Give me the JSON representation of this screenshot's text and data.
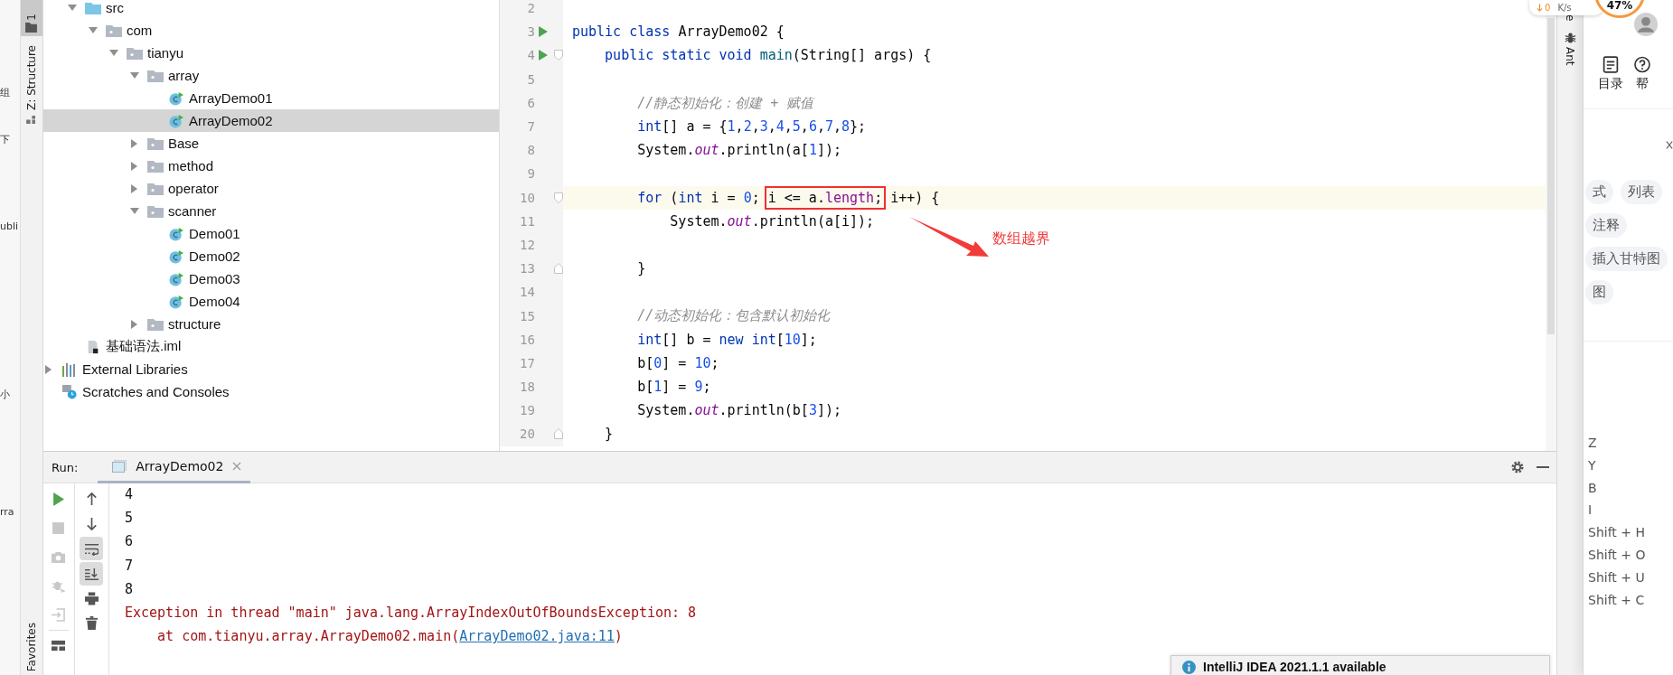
{
  "edge_fragments": [
    "组",
    "下",
    "ubli",
    "小",
    "rra"
  ],
  "tool_strip": {
    "project_tab": "1",
    "structure_tab": "Z: Structure",
    "favorites_tab": "Favorites"
  },
  "tree": {
    "module_children": [
      {
        "label": "src",
        "kind": "source-folder",
        "expanded": true,
        "selected": false,
        "children": [
          {
            "label": "com",
            "kind": "package",
            "expanded": true,
            "selected": false,
            "children": [
              {
                "label": "tianyu",
                "kind": "package",
                "expanded": true,
                "selected": false,
                "children": [
                  {
                    "label": "array",
                    "kind": "package",
                    "expanded": true,
                    "selected": false,
                    "children": [
                      {
                        "label": "ArrayDemo01",
                        "kind": "class",
                        "selected": false
                      },
                      {
                        "label": "ArrayDemo02",
                        "kind": "class",
                        "selected": true
                      }
                    ]
                  },
                  {
                    "label": "Base",
                    "kind": "package",
                    "expanded": false,
                    "selected": false
                  },
                  {
                    "label": "method",
                    "kind": "package",
                    "expanded": false,
                    "selected": false
                  },
                  {
                    "label": "operator",
                    "kind": "package",
                    "expanded": false,
                    "selected": false
                  },
                  {
                    "label": "scanner",
                    "kind": "package",
                    "expanded": true,
                    "selected": false,
                    "children": [
                      {
                        "label": "Demo01",
                        "kind": "class",
                        "selected": false
                      },
                      {
                        "label": "Demo02",
                        "kind": "class",
                        "selected": false
                      },
                      {
                        "label": "Demo03",
                        "kind": "class",
                        "selected": false
                      },
                      {
                        "label": "Demo04",
                        "kind": "class",
                        "selected": false
                      }
                    ]
                  },
                  {
                    "label": "structure",
                    "kind": "package",
                    "expanded": false,
                    "selected": false
                  }
                ]
              }
            ]
          }
        ]
      },
      {
        "label": "基础语法.iml",
        "kind": "module-file",
        "selected": false
      }
    ],
    "roots": [
      {
        "label": "External Libraries",
        "kind": "libraries",
        "expanded": false,
        "selected": false
      },
      {
        "label": "Scratches and Consoles",
        "kind": "scratches",
        "selected": false
      }
    ]
  },
  "editor": {
    "lines": [
      {
        "number": "2",
        "run": false,
        "fold_open": false,
        "fold_close": false,
        "current": false
      },
      {
        "number": "3",
        "run": true,
        "fold_open": false,
        "fold_close": false,
        "current": false,
        "tokens": [
          {
            "text": "public class ",
            "kind": "keyword"
          },
          {
            "text": "ArrayDemo02 {",
            "kind": "plain"
          }
        ]
      },
      {
        "number": "4",
        "run": true,
        "fold_open": true,
        "fold_close": false,
        "current": false,
        "tokens": [
          {
            "text": "    public static void ",
            "kind": "keyword"
          },
          {
            "text": "main",
            "kind": "method-decl"
          },
          {
            "text": "(String[] args) {",
            "kind": "plain"
          }
        ]
      },
      {
        "number": "5",
        "run": false,
        "fold_open": false,
        "fold_close": false,
        "current": false
      },
      {
        "number": "6",
        "run": false,
        "fold_open": false,
        "fold_close": false,
        "current": false,
        "tokens": [
          {
            "text": "        //静态初始化：创建 + 赋值",
            "kind": "comment"
          }
        ]
      },
      {
        "number": "7",
        "run": false,
        "fold_open": false,
        "fold_close": false,
        "current": false,
        "tokens": [
          {
            "text": "        int",
            "kind": "keyword"
          },
          {
            "text": "[] a = {",
            "kind": "plain"
          },
          {
            "text": "1",
            "kind": "number"
          },
          {
            "text": ",",
            "kind": "plain"
          },
          {
            "text": "2",
            "kind": "number"
          },
          {
            "text": ",",
            "kind": "plain"
          },
          {
            "text": "3",
            "kind": "number"
          },
          {
            "text": ",",
            "kind": "plain"
          },
          {
            "text": "4",
            "kind": "number"
          },
          {
            "text": ",",
            "kind": "plain"
          },
          {
            "text": "5",
            "kind": "number"
          },
          {
            "text": ",",
            "kind": "plain"
          },
          {
            "text": "6",
            "kind": "number"
          },
          {
            "text": ",",
            "kind": "plain"
          },
          {
            "text": "7",
            "kind": "number"
          },
          {
            "text": ",",
            "kind": "plain"
          },
          {
            "text": "8",
            "kind": "number"
          },
          {
            "text": "};",
            "kind": "plain"
          }
        ]
      },
      {
        "number": "8",
        "run": false,
        "fold_open": false,
        "fold_close": false,
        "current": false,
        "tokens": [
          {
            "text": "        System.",
            "kind": "plain"
          },
          {
            "text": "out",
            "kind": "static-field"
          },
          {
            "text": ".println(a[",
            "kind": "plain"
          },
          {
            "text": "1",
            "kind": "number"
          },
          {
            "text": "]);",
            "kind": "plain"
          }
        ]
      },
      {
        "number": "9",
        "run": false,
        "fold_open": false,
        "fold_close": false,
        "current": false
      },
      {
        "number": "10",
        "run": false,
        "fold_open": true,
        "fold_close": false,
        "current": true,
        "tokens": [
          {
            "text": "        for ",
            "kind": "keyword"
          },
          {
            "text": "(",
            "kind": "plain"
          },
          {
            "text": "int ",
            "kind": "keyword"
          },
          {
            "text": "i = ",
            "kind": "plain"
          },
          {
            "text": "0",
            "kind": "number"
          },
          {
            "text": "; ",
            "kind": "plain"
          },
          {
            "kind": "box",
            "tokens": [
              {
                "text": "i <= a.",
                "kind": "plain"
              },
              {
                "text": "length",
                "kind": "field"
              },
              {
                "text": ";",
                "kind": "plain"
              }
            ]
          },
          {
            "text": " i++) {",
            "kind": "plain"
          }
        ]
      },
      {
        "number": "11",
        "run": false,
        "fold_open": false,
        "fold_close": false,
        "current": false,
        "tokens": [
          {
            "text": "            System.",
            "kind": "plain"
          },
          {
            "text": "out",
            "kind": "static-field"
          },
          {
            "text": ".println(a[i]);",
            "kind": "plain"
          }
        ]
      },
      {
        "number": "12",
        "run": false,
        "fold_open": false,
        "fold_close": false,
        "current": false
      },
      {
        "number": "13",
        "run": false,
        "fold_open": false,
        "fold_close": true,
        "current": false,
        "tokens": [
          {
            "text": "        }",
            "kind": "plain"
          }
        ]
      },
      {
        "number": "14",
        "run": false,
        "fold_open": false,
        "fold_close": false,
        "current": false
      },
      {
        "number": "15",
        "run": false,
        "fold_open": false,
        "fold_close": false,
        "current": false,
        "tokens": [
          {
            "text": "        //动态初始化：包含默认初始化",
            "kind": "comment"
          }
        ]
      },
      {
        "number": "16",
        "run": false,
        "fold_open": false,
        "fold_close": false,
        "current": false,
        "tokens": [
          {
            "text": "        int",
            "kind": "keyword"
          },
          {
            "text": "[] b = ",
            "kind": "plain"
          },
          {
            "text": "new int",
            "kind": "keyword"
          },
          {
            "text": "[",
            "kind": "plain"
          },
          {
            "text": "10",
            "kind": "number"
          },
          {
            "text": "];",
            "kind": "plain"
          }
        ]
      },
      {
        "number": "17",
        "run": false,
        "fold_open": false,
        "fold_close": false,
        "current": false,
        "tokens": [
          {
            "text": "        b[",
            "kind": "plain"
          },
          {
            "text": "0",
            "kind": "number"
          },
          {
            "text": "] = ",
            "kind": "plain"
          },
          {
            "text": "10",
            "kind": "number"
          },
          {
            "text": ";",
            "kind": "plain"
          }
        ]
      },
      {
        "number": "18",
        "run": false,
        "fold_open": false,
        "fold_close": false,
        "current": false,
        "tokens": [
          {
            "text": "        b[",
            "kind": "plain"
          },
          {
            "text": "1",
            "kind": "number"
          },
          {
            "text": "] = ",
            "kind": "plain"
          },
          {
            "text": "9",
            "kind": "number"
          },
          {
            "text": ";",
            "kind": "plain"
          }
        ]
      },
      {
        "number": "19",
        "run": false,
        "fold_open": false,
        "fold_close": false,
        "current": false,
        "tokens": [
          {
            "text": "        System.",
            "kind": "plain"
          },
          {
            "text": "out",
            "kind": "static-field"
          },
          {
            "text": ".println(b[",
            "kind": "plain"
          },
          {
            "text": "3",
            "kind": "number"
          },
          {
            "text": "]);",
            "kind": "plain"
          }
        ]
      },
      {
        "number": "20",
        "run": false,
        "fold_open": false,
        "fold_close": true,
        "current": false,
        "tokens": [
          {
            "text": "    }",
            "kind": "plain"
          }
        ]
      }
    ],
    "annotation": {
      "label": "数组越界"
    }
  },
  "run_panel": {
    "label": "Run:",
    "tabs": [
      {
        "label": "ArrayDemo02",
        "selected": true
      }
    ],
    "console": [
      {
        "kind": "output",
        "text": "4"
      },
      {
        "kind": "output",
        "text": "5"
      },
      {
        "kind": "output",
        "text": "6"
      },
      {
        "kind": "output",
        "text": "7"
      },
      {
        "kind": "output",
        "text": "8"
      },
      {
        "kind": "error",
        "text": "Exception in thread \"main\" java.lang.ArrayIndexOutOfBoundsException: 8"
      },
      {
        "kind": "error",
        "text": "    at com.tianyu.array.ArrayDemo02.main(",
        "link": "ArrayDemo02.java:11",
        "after": ")"
      }
    ]
  },
  "ide_right_strip": {
    "tabs": [
      "e",
      "Ant"
    ]
  },
  "speed_widget": {
    "value": "0",
    "unit": "K/s",
    "percent": "47%"
  },
  "browser_panel": {
    "toolbar": [
      "目录",
      "帮"
    ],
    "tags": [
      "式",
      "列表",
      "注释",
      "插入甘特图",
      "图"
    ],
    "shortcuts": [
      "Z",
      "Y",
      "B",
      "I",
      "Shift + H",
      "Shift + O",
      "Shift + U",
      "Shift + C"
    ]
  },
  "notification": {
    "title": "IntelliJ IDEA 2021.1.1 available"
  }
}
